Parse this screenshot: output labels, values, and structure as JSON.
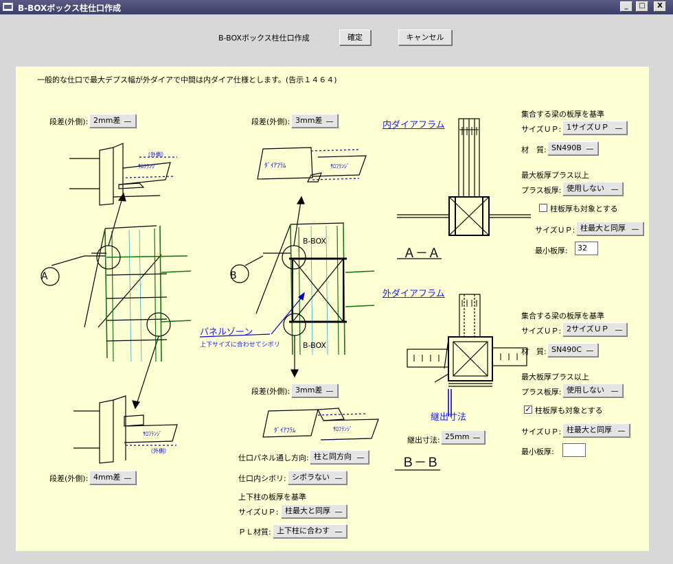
{
  "window": {
    "title": "B-BOXボックス柱仕口作成",
    "buttons": [
      "_",
      "□",
      "X"
    ]
  },
  "top": {
    "label": "B-BOXボックス柱仕口作成",
    "ok": "確定",
    "cancel": "キャンセル"
  },
  "note": "一般的な仕口で最大デプス幅が外ダイアで中間は内ダイア仕様とします。(告示１４６４)",
  "left": {
    "step_top_label": "段差(外側):",
    "step_top_value": "2mm差",
    "step_bottom_label": "段差(外側):",
    "step_bottom_value": "4mm差",
    "circle_label": "A",
    "sketch_flange": "ｻﾛﾌﾗﾝｼﾞ",
    "sketch_outside": "（外側）"
  },
  "middle": {
    "step_top_label": "段差(外側):",
    "step_top_value": "3mm差",
    "step_mid_label": "段差(外側):",
    "step_mid_value": "3mm差",
    "circle_label": "B",
    "bbox_top": "B-BOX",
    "bbox_bottom": "B-BOX",
    "diaphragm": "ﾀﾞｲｱﾌﾗﾑ",
    "flange": "ｻﾛﾌﾗﾝｼﾞ",
    "panel_zone": "パネルゾーン",
    "panel_zone_sub": "上下サイズに合わせてシボリ",
    "panel_dir_label": "仕口パネル通し方向:",
    "panel_dir_value": "柱と同方向",
    "inner_shibori_label": "仕口内シボリ:",
    "inner_shibori_value": "シボラない",
    "col_basis_heading": "上下柱の板厚を基準",
    "col_size_up_label": "サイズＵＰ:",
    "col_size_up_value": "柱最大と同厚",
    "pl_material_label": "ＰＬ材質:",
    "pl_material_value": "上下柱に合わす"
  },
  "aa": {
    "heading": "内ダイアフラム",
    "section": "Ａ－Ａ",
    "basis_heading": "集合する梁の板厚を基準",
    "size_up_label": "サイズＵＰ:",
    "size_up_value": "1サイズＵＰ",
    "material_label": "材　質:",
    "material_value": "SN490B",
    "max_plus_heading": "最大板厚プラス以上",
    "plus_label": "プラス板厚:",
    "plus_value": "使用しない",
    "col_target_label": "柱板厚も対象とする",
    "col_target_checked": "",
    "size_up2_label": "サイズＵＰ:",
    "size_up2_value": "柱最大と同厚",
    "min_thick_label": "最小板厚:",
    "min_thick_value": "32"
  },
  "bb": {
    "heading": "外ダイアフラム",
    "section": "Ｂ－Ｂ",
    "protrude_heading": "継出寸法",
    "protrude_label": "継出寸法:",
    "protrude_value": "25mm",
    "basis_heading": "集合する梁の板厚を基準",
    "size_up_label": "サイズＵＰ:",
    "size_up_value": "2サイズＵＰ",
    "material_label": "材　質:",
    "material_value": "SN490C",
    "max_plus_heading": "最大板厚プラス以上",
    "plus_label": "プラス板厚:",
    "plus_value": "使用しない",
    "col_target_label": "柱板厚も対象とする",
    "col_target_checked": "✓",
    "size_up2_label": "サイズＵＰ:",
    "size_up2_value": "柱最大と同厚",
    "min_thick_label": "最小板厚:",
    "min_thick_value": ""
  }
}
